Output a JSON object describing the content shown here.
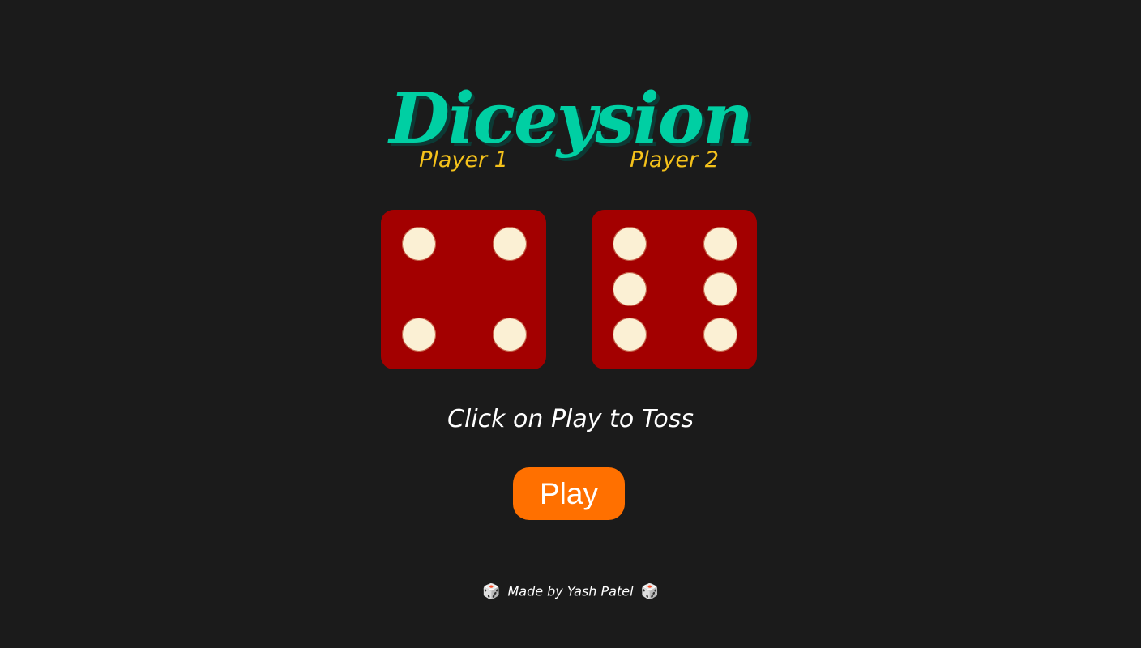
{
  "app": {
    "title": "Diceysion"
  },
  "players": [
    {
      "label": "Player 1",
      "die_value": 4
    },
    {
      "label": "Player 2",
      "die_value": 6
    }
  ],
  "status_text": "Click on Play to Toss",
  "play_button": {
    "label": "Play"
  },
  "footer": {
    "text": "Made by Yash Patel",
    "icon": "dice-icon",
    "icon_glyph": "🎲"
  },
  "colors": {
    "background": "#1b1b1b",
    "title": "#00cfa3",
    "player_label": "#f5c21b",
    "die_face": "#a30000",
    "pip": "#fbf0d4",
    "button": "#ff7000",
    "text": "#ffffff"
  }
}
